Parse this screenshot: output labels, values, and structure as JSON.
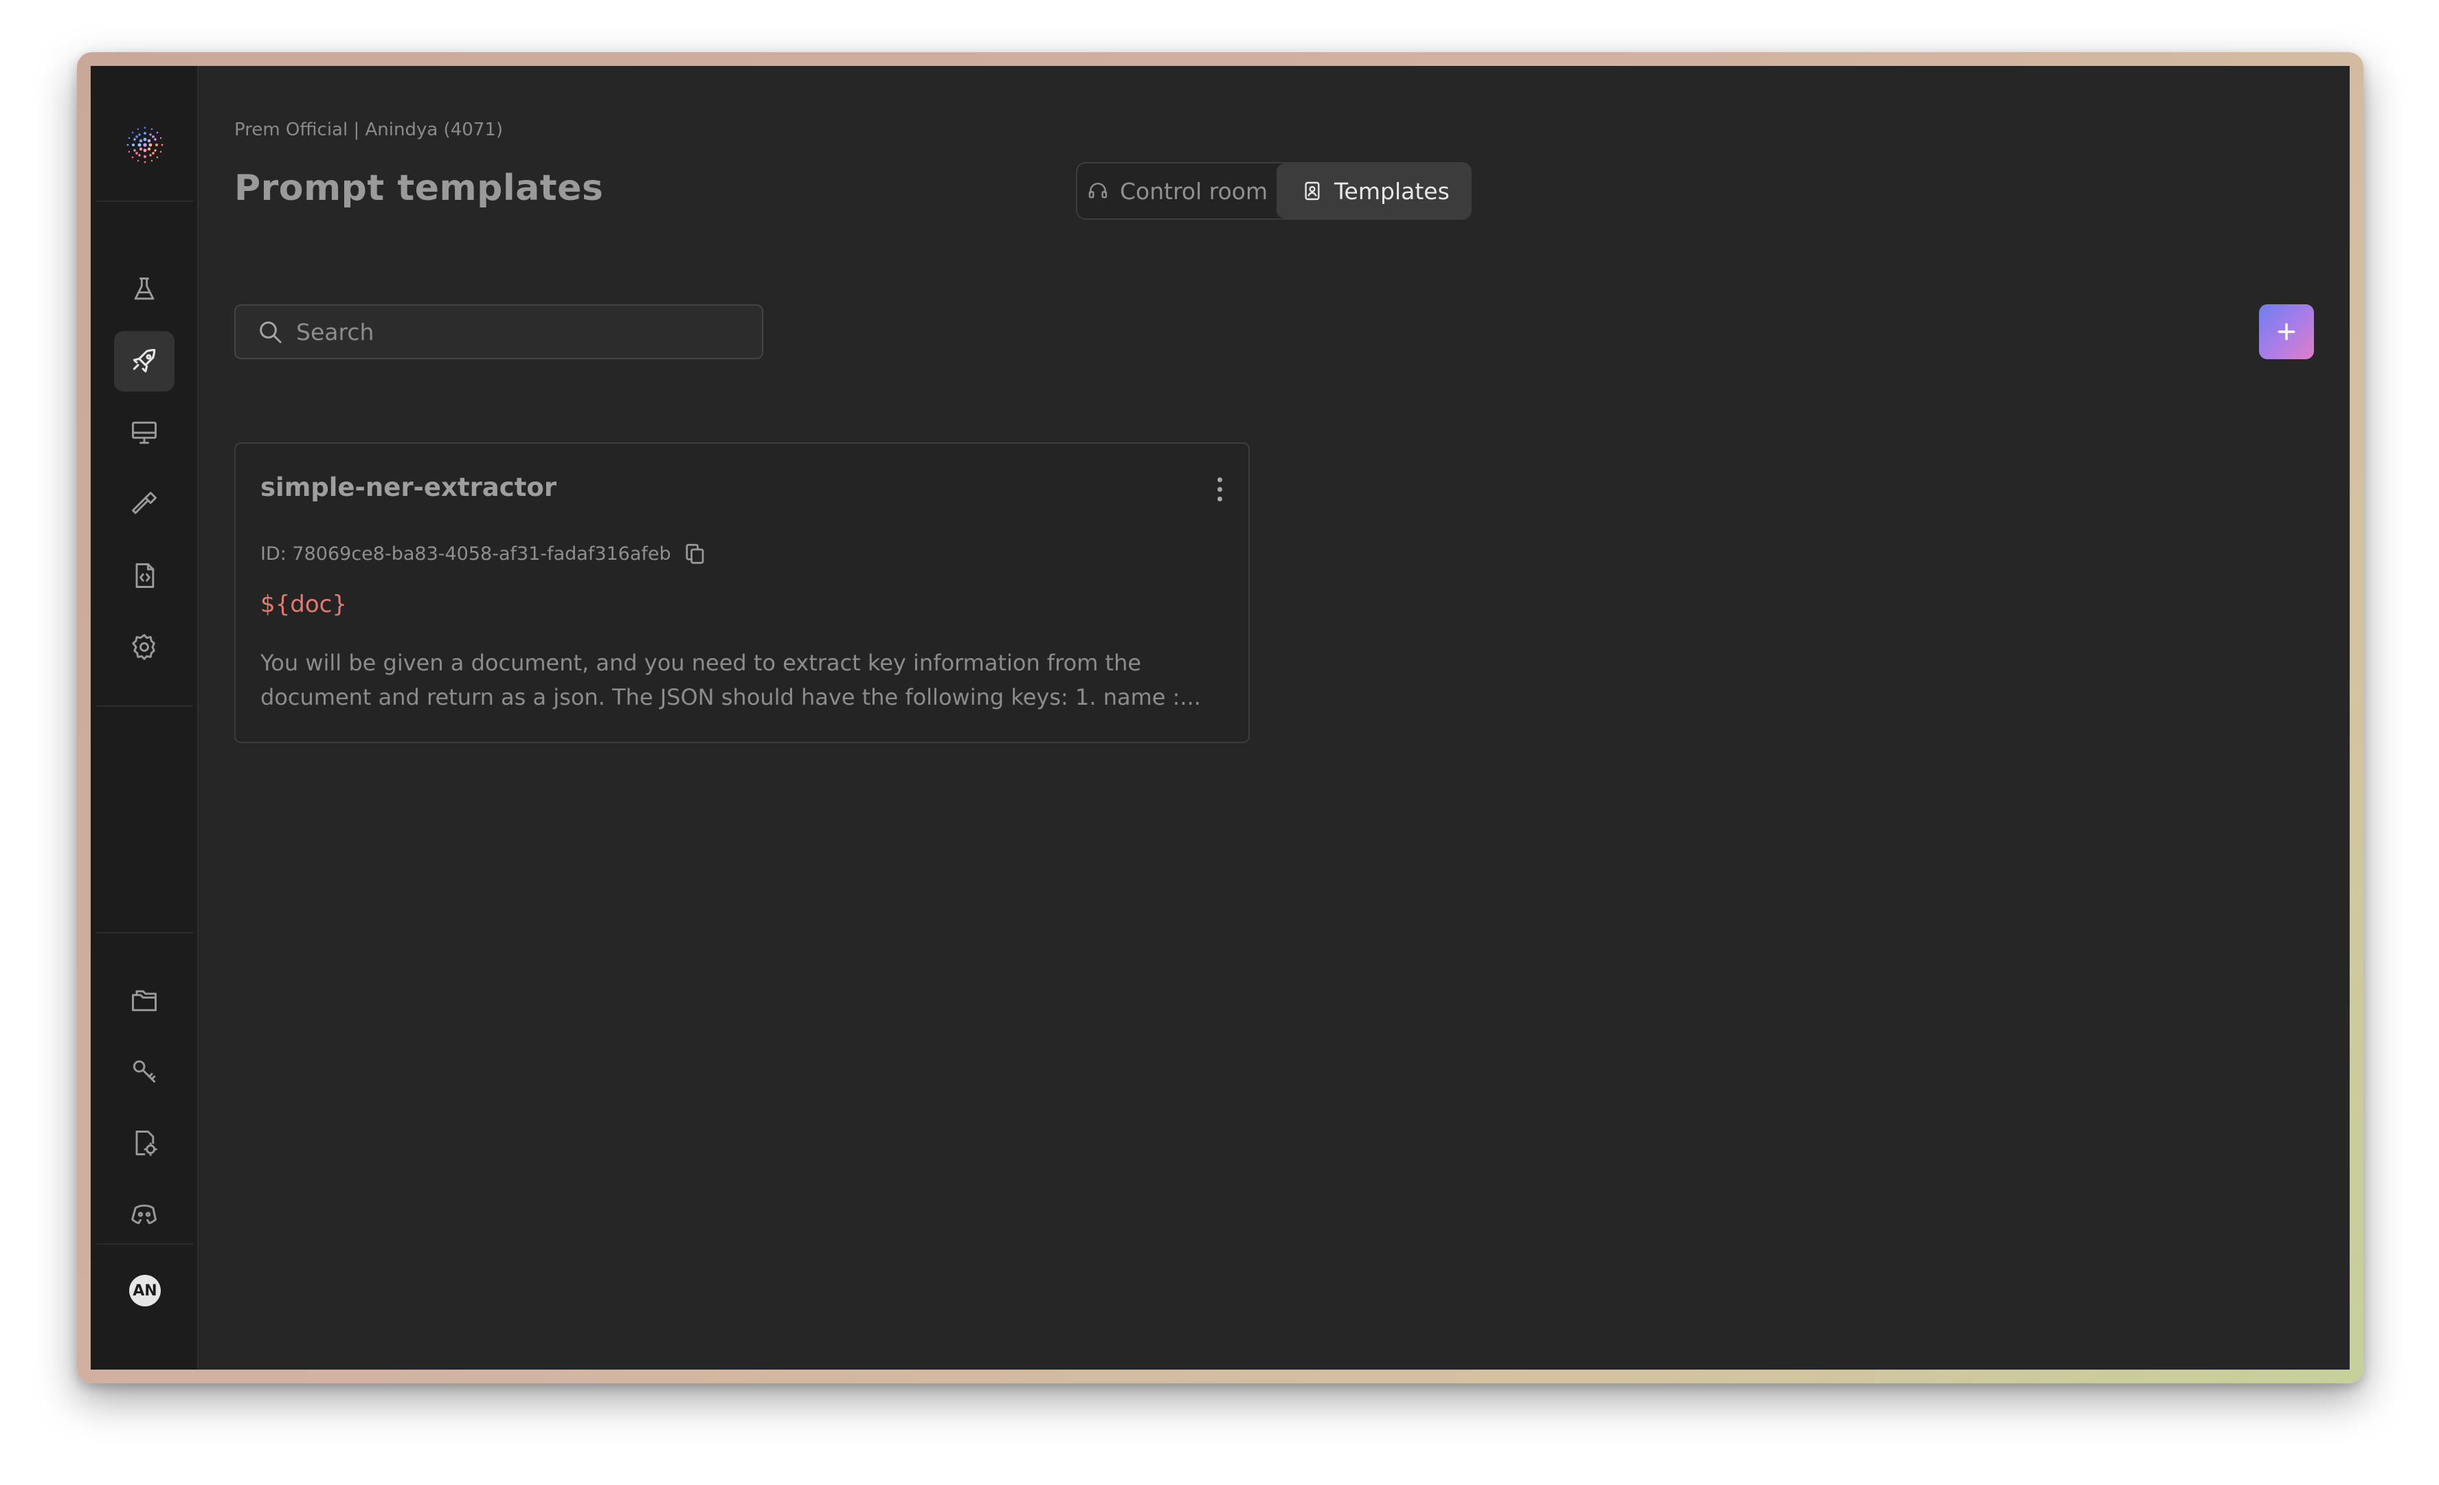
{
  "breadcrumb": "Prem Official | Anindya (4071)",
  "page_title": "Prompt templates",
  "tabs": [
    {
      "label": "Control room",
      "icon": "headset-icon",
      "active": false
    },
    {
      "label": "Templates",
      "icon": "template-icon",
      "active": true
    }
  ],
  "search": {
    "placeholder": "Search",
    "value": ""
  },
  "add_button": {
    "icon": "plus-icon",
    "colors": [
      "#6e7ef0",
      "#a77de8",
      "#e07ec9"
    ]
  },
  "sidebar": {
    "top_items": [
      {
        "icon": "flask-icon",
        "active": false
      },
      {
        "icon": "rocket-icon",
        "active": true
      },
      {
        "icon": "monitor-icon",
        "active": false
      },
      {
        "icon": "hammer-icon",
        "active": false
      },
      {
        "icon": "code-file-icon",
        "active": false
      },
      {
        "icon": "gear-icon",
        "active": false
      }
    ],
    "bottom_items": [
      {
        "icon": "folders-icon"
      },
      {
        "icon": "key-icon"
      },
      {
        "icon": "file-settings-icon"
      },
      {
        "icon": "discord-icon"
      }
    ],
    "avatar_initials": "AN"
  },
  "templates": [
    {
      "title": "simple-ner-extractor",
      "id_text": "ID: 78069ce8-ba83-4058-af31-fadaf316afeb",
      "variable": "${doc}",
      "description": "You will be given a document, and you need to extract key information from the document and return as a json. The JSON should have the following keys: 1. name :..."
    }
  ],
  "colors": {
    "background": "#262626",
    "sidebar": "#1c1c1c",
    "variable_accent": "#e27a6f"
  }
}
